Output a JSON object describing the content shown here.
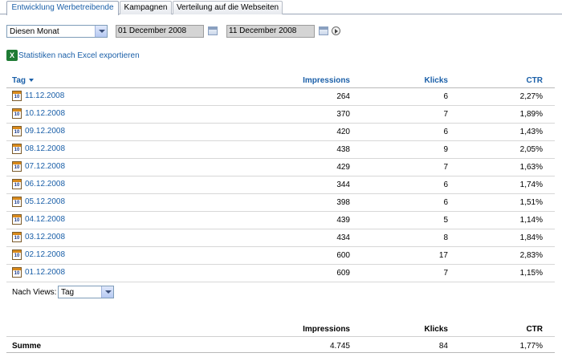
{
  "tabs": [
    {
      "label": "Entwicklung Werbetreibende",
      "active": true
    },
    {
      "label": "Kampagnen",
      "active": false
    },
    {
      "label": "Verteilung auf die Webseiten",
      "active": false
    }
  ],
  "filter": {
    "period_value": "Diesen Monat",
    "date_from": "01 December 2008",
    "date_to": "11 December 2008"
  },
  "export_label": "Statistiken nach Excel exportieren",
  "table": {
    "headers": {
      "tag": "Tag",
      "impressions": "Impressions",
      "klicks": "Klicks",
      "ctr": "CTR"
    },
    "rows": [
      {
        "date": "11.12.2008",
        "impressions": "264",
        "klicks": "6",
        "ctr": "2,27%"
      },
      {
        "date": "10.12.2008",
        "impressions": "370",
        "klicks": "7",
        "ctr": "1,89%"
      },
      {
        "date": "09.12.2008",
        "impressions": "420",
        "klicks": "6",
        "ctr": "1,43%"
      },
      {
        "date": "08.12.2008",
        "impressions": "438",
        "klicks": "9",
        "ctr": "2,05%"
      },
      {
        "date": "07.12.2008",
        "impressions": "429",
        "klicks": "7",
        "ctr": "1,63%"
      },
      {
        "date": "06.12.2008",
        "impressions": "344",
        "klicks": "6",
        "ctr": "1,74%"
      },
      {
        "date": "05.12.2008",
        "impressions": "398",
        "klicks": "6",
        "ctr": "1,51%"
      },
      {
        "date": "04.12.2008",
        "impressions": "439",
        "klicks": "5",
        "ctr": "1,14%"
      },
      {
        "date": "03.12.2008",
        "impressions": "434",
        "klicks": "8",
        "ctr": "1,84%"
      },
      {
        "date": "02.12.2008",
        "impressions": "600",
        "klicks": "17",
        "ctr": "2,83%"
      },
      {
        "date": "01.12.2008",
        "impressions": "609",
        "klicks": "7",
        "ctr": "1,15%"
      }
    ],
    "calendar_icon_text": "10"
  },
  "views": {
    "label": "Nach Views:",
    "value": "Tag"
  },
  "summary": {
    "headers": {
      "impressions": "Impressions",
      "klicks": "Klicks",
      "ctr": "CTR"
    },
    "label": "Summe",
    "impressions": "4.745",
    "klicks": "84",
    "ctr": "1,77%"
  },
  "icons": {
    "sort": "chevron-down-icon",
    "calendar": "calendar-icon",
    "excel": "excel-icon",
    "go": "play-circle-icon"
  }
}
